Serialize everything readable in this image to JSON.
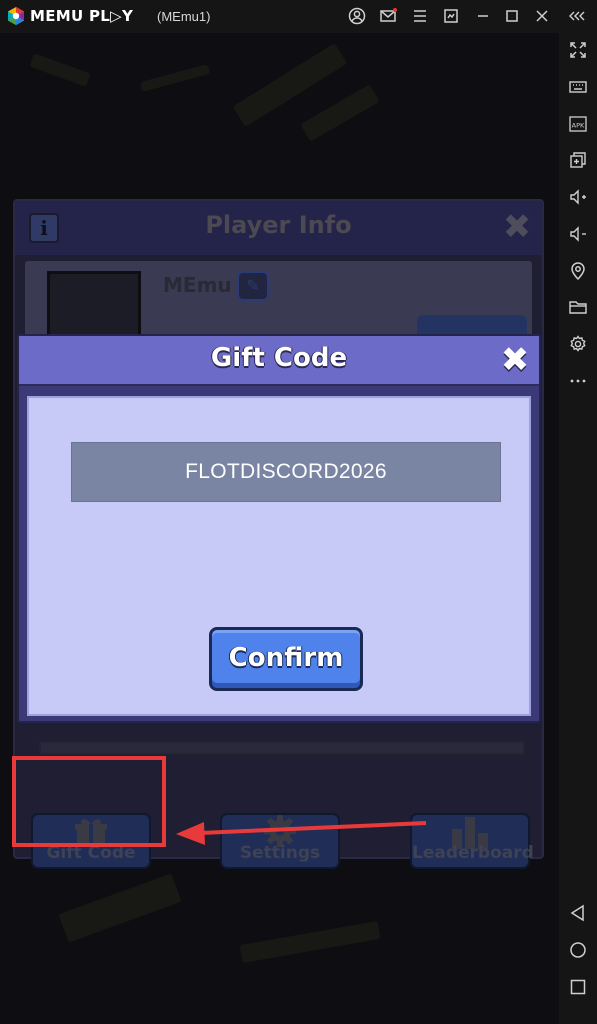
{
  "window": {
    "brand": "MEMU PL▷Y",
    "instance": "(MEmu1)",
    "title_icons": [
      "user-account-icon",
      "mail-icon",
      "menu-icon",
      "screenshot-icon",
      "minimize-icon",
      "maximize-icon",
      "close-icon",
      "collapse-sidebar-icon"
    ]
  },
  "sidebar": {
    "icons": [
      "fullscreen-icon",
      "keyboard-icon",
      "apk-icon",
      "multi-instance-icon",
      "volume-up-icon",
      "volume-down-icon",
      "location-icon",
      "folder-icon",
      "settings-icon",
      "more-icon",
      "back-icon",
      "home-icon",
      "recents-icon"
    ],
    "apk_label": "APK"
  },
  "player_info": {
    "info_label": "i",
    "title": "Player Info",
    "close_label": "✖",
    "player_name": "MEmu",
    "buttons": [
      {
        "label": "Gift Code",
        "icon": "gift-icon"
      },
      {
        "label": "Settings",
        "icon": "gear-icon"
      },
      {
        "label": "Leaderboard",
        "icon": "bar-chart-icon"
      }
    ]
  },
  "gift_dialog": {
    "title": "Gift Code",
    "close_label": "✖",
    "code_value": "FLOTDISCORD2026",
    "confirm_label": "Confirm"
  },
  "colors": {
    "highlight": "#e83a3a",
    "dialog_header": "#6c6bc7",
    "dialog_body": "#c7c9f6",
    "confirm_button": "#4f82ea"
  }
}
